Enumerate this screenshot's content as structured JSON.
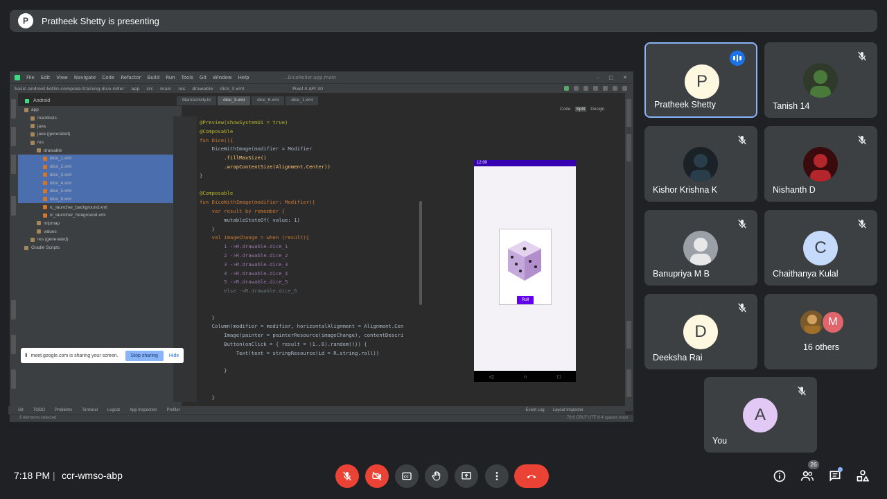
{
  "banner": {
    "avatar_letter": "P",
    "text": "Pratheek Shetty is presenting"
  },
  "shared_screen": {
    "menu": [
      "File",
      "Edit",
      "View",
      "Navigate",
      "Code",
      "Refactor",
      "Build",
      "Run",
      "Tools",
      "Git",
      "Window",
      "Help"
    ],
    "window_title": "...DiceRoller.app.main",
    "path": [
      "basic-android-kotlin-compose-training-dice-roller",
      "app",
      "src",
      "main",
      "res",
      "drawable",
      "dice_3.xml"
    ],
    "project_view": "Android",
    "device": "Pixel 4 API 30",
    "tabs": [
      "MainActivity.kt",
      "dice_3.xml",
      "dice_6.xml",
      "dice_1.xml"
    ],
    "view_modes": [
      "Code",
      "Split",
      "Design"
    ],
    "tree": [
      {
        "label": "app",
        "indent": 1,
        "kind": "folder",
        "sel": false
      },
      {
        "label": "manifests",
        "indent": 2,
        "kind": "folder",
        "sel": false
      },
      {
        "label": "java",
        "indent": 2,
        "kind": "folder",
        "sel": false
      },
      {
        "label": "java (generated)",
        "indent": 2,
        "kind": "folder",
        "sel": false
      },
      {
        "label": "res",
        "indent": 2,
        "kind": "folder",
        "sel": false
      },
      {
        "label": "drawable",
        "indent": 3,
        "kind": "folder",
        "sel": false
      },
      {
        "label": "dice_1.xml",
        "indent": 4,
        "kind": "xml",
        "sel": true
      },
      {
        "label": "dice_2.xml",
        "indent": 4,
        "kind": "xml",
        "sel": true
      },
      {
        "label": "dice_3.xml",
        "indent": 4,
        "kind": "xml",
        "sel": true
      },
      {
        "label": "dice_4.xml",
        "indent": 4,
        "kind": "xml",
        "sel": true
      },
      {
        "label": "dice_5.xml",
        "indent": 4,
        "kind": "xml",
        "sel": true
      },
      {
        "label": "dice_6.xml",
        "indent": 4,
        "kind": "xml",
        "sel": true
      },
      {
        "label": "ic_launcher_background.xml",
        "indent": 4,
        "kind": "xml",
        "sel": false
      },
      {
        "label": "ic_launcher_foreground.xml",
        "indent": 4,
        "kind": "xml",
        "sel": false
      },
      {
        "label": "mipmap",
        "indent": 3,
        "kind": "folder",
        "sel": false
      },
      {
        "label": "values",
        "indent": 3,
        "kind": "folder",
        "sel": false
      },
      {
        "label": "res (generated)",
        "indent": 2,
        "kind": "folder",
        "sel": false
      },
      {
        "label": "Gradle Scripts",
        "indent": 1,
        "kind": "folder",
        "sel": false
      }
    ],
    "code_lines": [
      {
        "t": "@Preview(showSystemUi = true)",
        "c": "c-ann"
      },
      {
        "t": "@Composable",
        "c": "c-ann"
      },
      {
        "t": "fun Dice(){",
        "c": "c-kw"
      },
      {
        "t": "    DiceWithImage(modifier = Modifier",
        "c": "c-txt"
      },
      {
        "t": "        .fillMaxSize()",
        "c": "c-fn"
      },
      {
        "t": "        .wrapContentSize(Alignment.Center))",
        "c": "c-fn"
      },
      {
        "t": "}",
        "c": "c-txt"
      },
      {
        "t": "",
        "c": "c-txt"
      },
      {
        "t": "@Composable",
        "c": "c-ann"
      },
      {
        "t": "fun DiceWithImage(modifier: Modifier){",
        "c": "c-kw"
      },
      {
        "t": "    var result by remember {",
        "c": "c-kw"
      },
      {
        "t": "        mutableStateOf( value: 1)",
        "c": "c-txt"
      },
      {
        "t": "    }",
        "c": "c-txt"
      },
      {
        "t": "    val imageChange = when (result){",
        "c": "c-kw"
      },
      {
        "t": "        1 ->R.drawable.dice_1",
        "c": "c-pu"
      },
      {
        "t": "        2 ->R.drawable.dice_2",
        "c": "c-pu"
      },
      {
        "t": "        3 ->R.drawable.dice_3",
        "c": "c-pu"
      },
      {
        "t": "        4 ->R.drawable.dice_4",
        "c": "c-pu"
      },
      {
        "t": "        5 ->R.drawable.dice_5",
        "c": "c-pu"
      },
      {
        "t": "        else ->R.drawable.dice_6",
        "c": "c-dim"
      },
      {
        "t": "",
        "c": "c-txt"
      },
      {
        "t": "",
        "c": "c-txt"
      },
      {
        "t": "    }",
        "c": "c-txt"
      },
      {
        "t": "    Column(modifier = modifier, horizontalAlignment = Alignment.Cen",
        "c": "c-txt"
      },
      {
        "t": "        Image(painter = painterResource(imageChange), contentDescri",
        "c": "c-txt"
      },
      {
        "t": "        Button(onClick = { result = (1..6).random()}) {",
        "c": "c-txt"
      },
      {
        "t": "            Text(text = stringResource(id = R.string.roll))",
        "c": "c-txt"
      },
      {
        "t": "",
        "c": "c-txt"
      },
      {
        "t": "        }",
        "c": "c-txt"
      },
      {
        "t": "",
        "c": "c-txt"
      },
      {
        "t": "",
        "c": "c-txt"
      },
      {
        "t": "    }",
        "c": "c-txt"
      }
    ],
    "phone_time": "12:00",
    "roll_label": "Roll",
    "bottom_tools": [
      "Git",
      "TODO",
      "Problems",
      "Terminal",
      "Logcat",
      "App Inspection",
      "Profiler"
    ],
    "right_tools": [
      "Event Log",
      "Layout Inspector"
    ],
    "status_left": "6 elements selected",
    "status_right": "78:6   CRLF   UTF-8   4 spaces   main"
  },
  "sharing_notice": {
    "text": "meet.google.com is sharing your screen.",
    "stop_label": "Stop sharing",
    "hide_label": "Hide"
  },
  "participants": [
    {
      "name": "Pratheek Shetty",
      "letter": "P",
      "avatar_bg": "#fff8e1",
      "avatar_fg": "#3c4043",
      "photo": false,
      "speaking": true
    },
    {
      "name": "Tanish 14",
      "letter": "",
      "photo": true,
      "photo_colors": [
        "#4a7a3a",
        "#2f3a2a"
      ],
      "muted": true
    },
    {
      "name": "Kishor Krishna K",
      "letter": "",
      "photo": true,
      "photo_colors": [
        "#2a3d4a",
        "#1a2228"
      ],
      "muted": true
    },
    {
      "name": "Nishanth D",
      "letter": "",
      "photo": true,
      "photo_colors": [
        "#b3262b",
        "#3a0b0d"
      ],
      "muted": true
    },
    {
      "name": "Banupriya M B",
      "letter": "",
      "photo": true,
      "photo_colors": [
        "#e8e8e8",
        "#9aa0a6"
      ],
      "muted": true
    },
    {
      "name": "Chaithanya Kulal",
      "letter": "C",
      "avatar_bg": "#c6dafc",
      "avatar_fg": "#3c4043",
      "photo": false,
      "muted": true
    },
    {
      "name": "Deeksha Rai",
      "letter": "D",
      "avatar_bg": "#fff8e1",
      "avatar_fg": "#3c4043",
      "photo": false,
      "muted": true
    },
    {
      "name": "You",
      "letter": "A",
      "avatar_bg": "#e1c8f5",
      "avatar_fg": "#3c4043",
      "photo": false,
      "muted": true
    }
  ],
  "others": {
    "label": "16 others",
    "letter": "M"
  },
  "footer": {
    "time": "7:18 PM",
    "separator": "|",
    "meeting_code": "ccr-wmso-abp",
    "people_count": "26"
  },
  "colors": {
    "background": "#202124",
    "tile": "#3c4043",
    "red": "#ea4335",
    "accent": "#8ab4f8"
  }
}
